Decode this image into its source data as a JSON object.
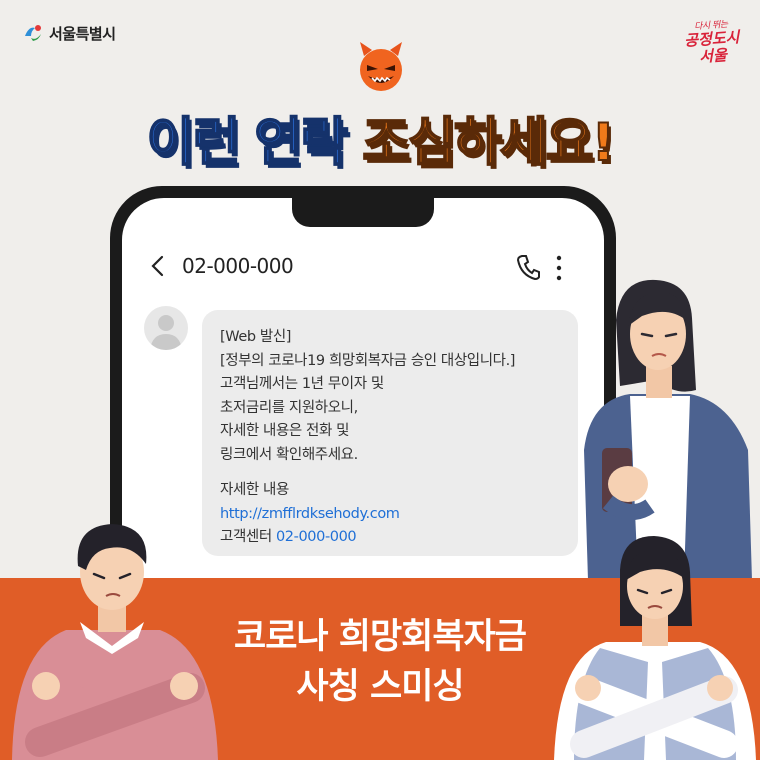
{
  "brand": {
    "logo_text": "서울특별시",
    "slogan_small": "다시 뛰는",
    "slogan_line1": "공정도시",
    "slogan_line2": "서울"
  },
  "headline": {
    "part1": "이런 연락",
    "part2": "조심하세요!"
  },
  "phone": {
    "number": "02-000-000",
    "message_lines": [
      "[Web 발신]",
      "[정부의 코로나19 희망회복자금 승인 대상입니다.]",
      "고객님께서는 1년 무이자 및",
      "초저금리를 지원하오니,",
      "자세한 내용은 전화 및",
      "링크에서 확인해주세요."
    ],
    "detail_label": "자세한 내용",
    "link": "http://zmfflrdksehody.com",
    "center_label": "고객센터",
    "center_number": "02-000-000"
  },
  "banner": {
    "line1": "코로나 희망회복자금",
    "line2": "사칭 스미싱"
  },
  "colors": {
    "background": "#f0eeeb",
    "headline_blue": "#2c73e0",
    "headline_orange": "#f07a1a",
    "banner_orange": "#e05d27",
    "link_blue": "#1f6fd6",
    "bubble_gray": "#ececec"
  },
  "icons": [
    "seoul-logo-icon",
    "devil-icon",
    "back-arrow-icon",
    "phone-call-icon",
    "more-vertical-icon",
    "default-avatar-icon"
  ]
}
